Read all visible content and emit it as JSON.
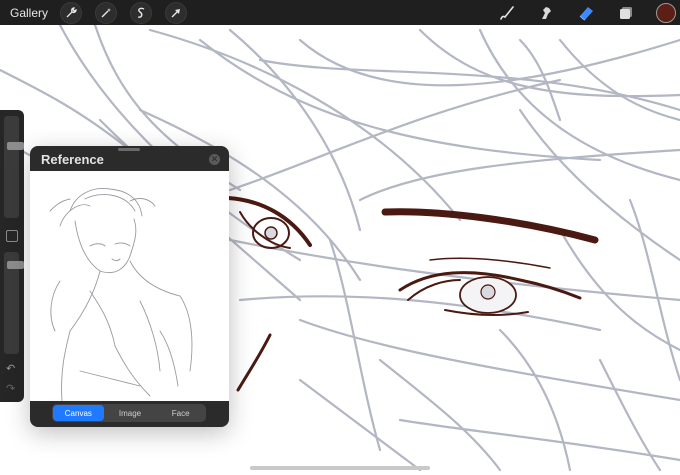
{
  "topbar": {
    "gallery_label": "Gallery",
    "left_tools": [
      "wrench-icon",
      "magic-wand-icon",
      "selection-s-icon",
      "transform-arrow-icon"
    ],
    "right_tools": [
      "brush-icon",
      "smudge-icon",
      "eraser-icon",
      "layers-icon"
    ],
    "active_tool": "eraser-icon",
    "current_color": "#5b1f16",
    "eraser_color": "#3a8bff"
  },
  "sidebar": {
    "size_slider_level": 0.72,
    "opacity_slider_level": 0.9,
    "icons": [
      "square-modify-icon",
      "undo-icon",
      "redo-icon"
    ]
  },
  "reference": {
    "title": "Reference",
    "tabs": [
      {
        "label": "Canvas",
        "active": true
      },
      {
        "label": "Image",
        "active": false
      },
      {
        "label": "Face",
        "active": false
      }
    ]
  },
  "canvas": {
    "sketch_color": "#b3b6c3",
    "ink_color": "#4a1a12"
  }
}
